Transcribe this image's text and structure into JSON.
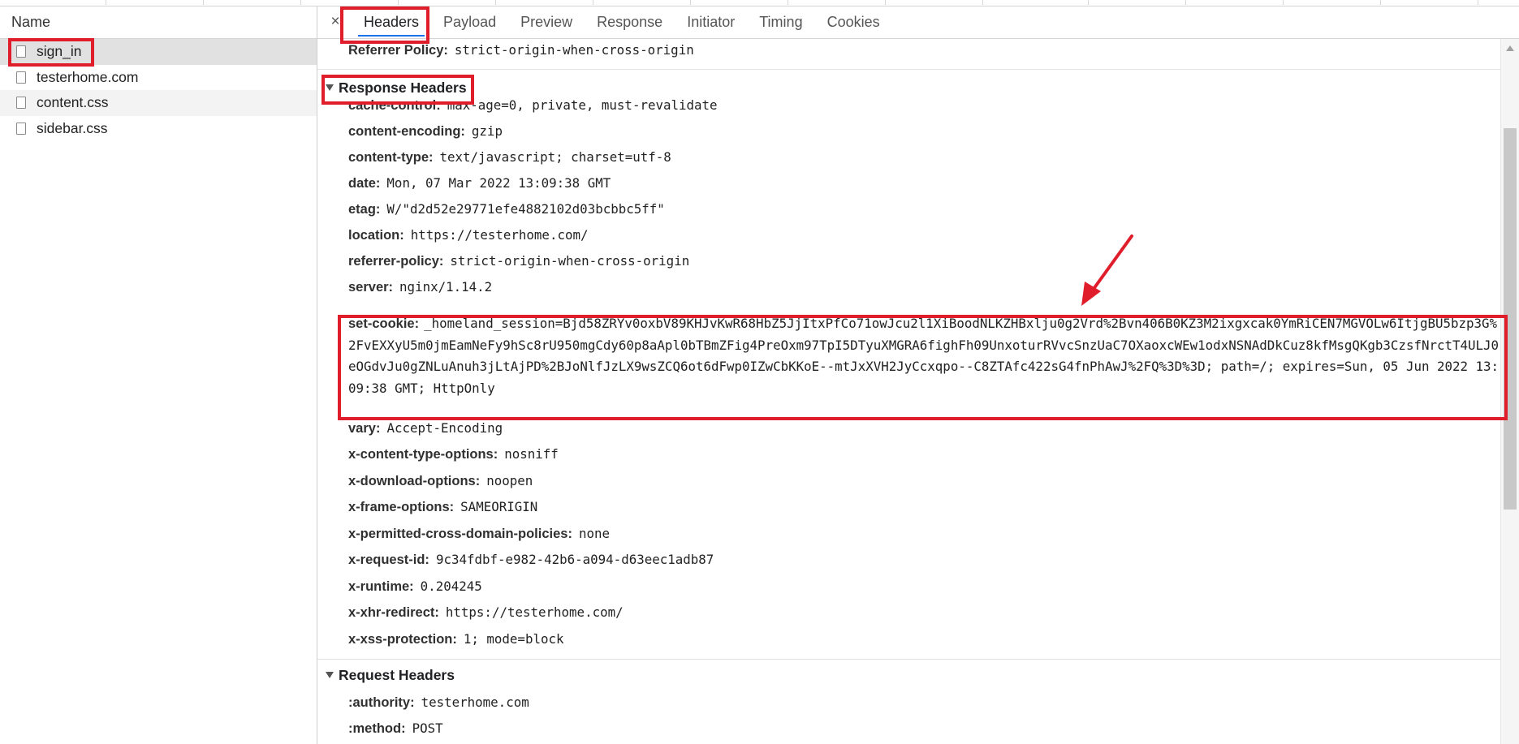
{
  "left_panel": {
    "header": "Name",
    "requests": [
      {
        "name": "sign_in"
      },
      {
        "name": "testerhome.com"
      },
      {
        "name": "content.css"
      },
      {
        "name": "sidebar.css"
      }
    ]
  },
  "tabs": [
    "Headers",
    "Payload",
    "Preview",
    "Response",
    "Initiator",
    "Timing",
    "Cookies"
  ],
  "close_symbol": "×",
  "general_tail": {
    "key": "Referrer Policy:",
    "value": "strict-origin-when-cross-origin"
  },
  "response_headers": {
    "title": "Response Headers",
    "items": [
      {
        "key": "cache-control:",
        "value": "max-age=0, private, must-revalidate"
      },
      {
        "key": "content-encoding:",
        "value": "gzip"
      },
      {
        "key": "content-type:",
        "value": "text/javascript; charset=utf-8"
      },
      {
        "key": "date:",
        "value": "Mon, 07 Mar 2022 13:09:38 GMT"
      },
      {
        "key": "etag:",
        "value": "W/\"d2d52e29771efe4882102d03bcbbc5ff\""
      },
      {
        "key": "location:",
        "value": "https://testerhome.com/"
      },
      {
        "key": "referrer-policy:",
        "value": "strict-origin-when-cross-origin"
      },
      {
        "key": "server:",
        "value": "nginx/1.14.2"
      }
    ],
    "set_cookie": {
      "key": "set-cookie:",
      "value": "_homeland_session=Bjd58ZRYv0oxbV89KHJvKwR68HbZ5JjItxPfCo71owJcu2l1XiBoodNLKZHBxlju0g2Vrd%2Bvn406B0KZ3M2ixgxcak0YmRiCEN7MGVOLw6ItjgBU5bzp3G%2FvEXXyU5m0jmEamNeFy9hSc8rU950mgCdy60p8aApl0bTBmZFig4PreOxm97TpI5DTyuXMGRA6fighFh09UnxoturRVvcSnzUaC7OXaoxcWEw1odxNSNAdDkCuz8kfMsgQKgb3CzsfNrctT4ULJ0eOGdvJu0gZNLuAnuh3jLtAjPD%2BJoNlfJzLX9wsZCQ6ot6dFwp0IZwCbKKoE--mtJxXVH2JyCcxqpo--C8ZTAfc422sG4fnPhAwJ%2FQ%3D%3D; path=/; expires=Sun, 05 Jun 2022 13:09:38 GMT; HttpOnly"
    },
    "items_after": [
      {
        "key": "vary:",
        "value": "Accept-Encoding"
      },
      {
        "key": "x-content-type-options:",
        "value": "nosniff"
      },
      {
        "key": "x-download-options:",
        "value": "noopen"
      },
      {
        "key": "x-frame-options:",
        "value": "SAMEORIGIN"
      },
      {
        "key": "x-permitted-cross-domain-policies:",
        "value": "none"
      },
      {
        "key": "x-request-id:",
        "value": "9c34fdbf-e982-42b6-a094-d63eec1adb87"
      },
      {
        "key": "x-runtime:",
        "value": "0.204245"
      },
      {
        "key": "x-xhr-redirect:",
        "value": "https://testerhome.com/"
      },
      {
        "key": "x-xss-protection:",
        "value": "1; mode=block"
      }
    ]
  },
  "request_headers": {
    "title": "Request Headers",
    "items": [
      {
        "key": ":authority:",
        "value": "testerhome.com"
      },
      {
        "key": ":method:",
        "value": "POST"
      }
    ]
  },
  "colors": {
    "annotation": "#e01e2b",
    "active_tab_underline": "#1a73e8"
  },
  "icons": [
    "file-icon",
    "close-icon",
    "disclosure-triangle-icon",
    "annotation-arrow-icon"
  ]
}
